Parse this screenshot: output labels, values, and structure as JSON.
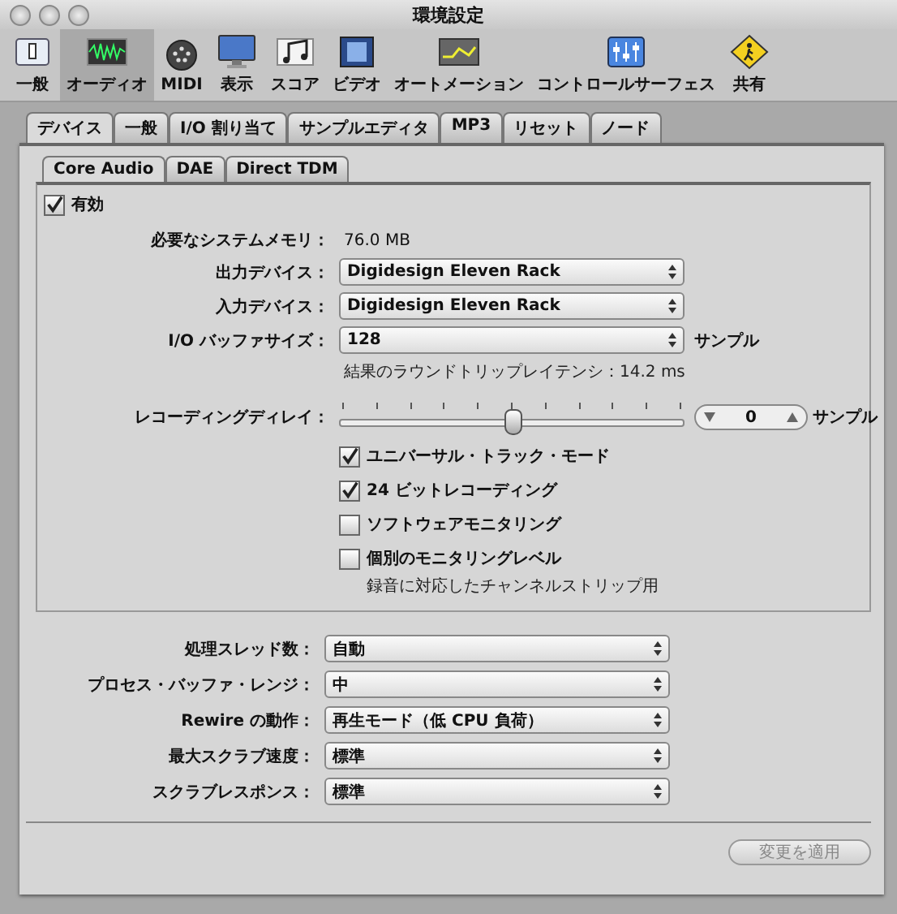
{
  "window": {
    "title": "環境設定"
  },
  "toolbar": [
    {
      "label": "一般",
      "selected": false
    },
    {
      "label": "オーディオ",
      "selected": true
    },
    {
      "label": "MIDI",
      "selected": false
    },
    {
      "label": "表示",
      "selected": false
    },
    {
      "label": "スコア",
      "selected": false
    },
    {
      "label": "ビデオ",
      "selected": false
    },
    {
      "label": "オートメーション",
      "selected": false
    },
    {
      "label": "コントロールサーフェス",
      "selected": false
    },
    {
      "label": "共有",
      "selected": false
    }
  ],
  "tabs": [
    {
      "label": "デバイス",
      "selected": true
    },
    {
      "label": "一般",
      "selected": false
    },
    {
      "label": "I/O 割り当て",
      "selected": false
    },
    {
      "label": "サンプルエディタ",
      "selected": false
    },
    {
      "label": "MP3",
      "selected": false
    },
    {
      "label": "リセット",
      "selected": false
    },
    {
      "label": "ノード",
      "selected": false
    }
  ],
  "subtabs": [
    {
      "label": "Core Audio",
      "selected": true
    },
    {
      "label": "DAE",
      "selected": false
    },
    {
      "label": "Direct TDM",
      "selected": false
    }
  ],
  "enabled": {
    "label": "有効",
    "checked": true
  },
  "memory": {
    "label": "必要なシステムメモリ：",
    "value": "76.0 MB"
  },
  "device_popups": [
    {
      "label": "出力デバイス：",
      "value": "Digidesign Eleven Rack"
    },
    {
      "label": "入力デバイス：",
      "value": "Digidesign Eleven Rack"
    },
    {
      "label": "I/O バッファサイズ：",
      "value": "128",
      "unit": "サンプル"
    }
  ],
  "latency": "結果のラウンドトリップレイテンシ：14.2 ms",
  "recording_delay": {
    "label": "レコーディングディレイ：",
    "level": 0.5,
    "value": "0",
    "unit": "サンプル"
  },
  "options": [
    {
      "label": "ユニバーサル・トラック・モード",
      "checked": true
    },
    {
      "label": "24 ビットレコーディング",
      "checked": true
    },
    {
      "label": "ソフトウェアモニタリング",
      "checked": false
    },
    {
      "label": "個別のモニタリングレベル",
      "checked": false,
      "note": "録音に対応したチャンネルストリップ用"
    }
  ],
  "bottom_popups": [
    {
      "label": "処理スレッド数：",
      "value": "自動"
    },
    {
      "label": "プロセス・バッファ・レンジ：",
      "value": "中"
    },
    {
      "label": "Rewire の動作：",
      "value": "再生モード（低 CPU 負荷）"
    },
    {
      "label": "最大スクラブ速度：",
      "value": "標準"
    },
    {
      "label": "スクラブレスポンス：",
      "value": "標準"
    }
  ],
  "apply_button": {
    "label": "変更を適用",
    "disabled": true
  }
}
